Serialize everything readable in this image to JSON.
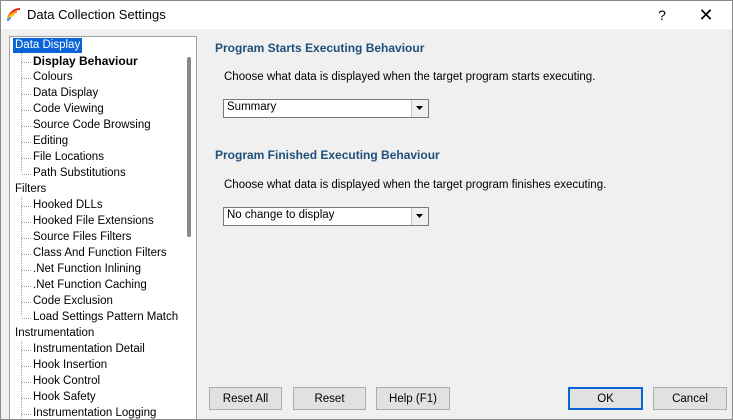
{
  "window": {
    "title": "Data Collection Settings",
    "help_glyph": "?",
    "close_glyph": "✕"
  },
  "tree": {
    "items": [
      {
        "label": "Data Display",
        "level": 0,
        "selected": true
      },
      {
        "label": "Display Behaviour",
        "level": 1,
        "bold": true
      },
      {
        "label": "Colours",
        "level": 1
      },
      {
        "label": "Data Display",
        "level": 1
      },
      {
        "label": "Code Viewing",
        "level": 1
      },
      {
        "label": "Source Code Browsing",
        "level": 1
      },
      {
        "label": "Editing",
        "level": 1
      },
      {
        "label": "File Locations",
        "level": 1
      },
      {
        "label": "Path Substitutions",
        "level": 1
      },
      {
        "label": "Filters",
        "level": 0
      },
      {
        "label": "Hooked DLLs",
        "level": 1
      },
      {
        "label": "Hooked File Extensions",
        "level": 1
      },
      {
        "label": "Source Files Filters",
        "level": 1
      },
      {
        "label": "Class And Function Filters",
        "level": 1
      },
      {
        "label": ".Net Function Inlining",
        "level": 1
      },
      {
        "label": ".Net Function Caching",
        "level": 1
      },
      {
        "label": "Code Exclusion",
        "level": 1
      },
      {
        "label": "Load Settings Pattern Match",
        "level": 1
      },
      {
        "label": "Instrumentation",
        "level": 0
      },
      {
        "label": "Instrumentation Detail",
        "level": 1
      },
      {
        "label": "Hook Insertion",
        "level": 1
      },
      {
        "label": "Hook Control",
        "level": 1
      },
      {
        "label": "Hook Safety",
        "level": 1
      },
      {
        "label": "Instrumentation Logging",
        "level": 1
      }
    ]
  },
  "main": {
    "start_heading": "Program Starts Executing Behaviour",
    "start_desc": "Choose what data is displayed when the target program starts executing.",
    "start_value": "Summary",
    "finish_heading": "Program Finished Executing Behaviour",
    "finish_desc": "Choose what data is displayed when the target program finishes executing.",
    "finish_value": "No change to display"
  },
  "buttons": {
    "reset_all": "Reset All",
    "reset": "Reset",
    "help": "Help (F1)",
    "ok": "OK",
    "cancel": "Cancel"
  }
}
